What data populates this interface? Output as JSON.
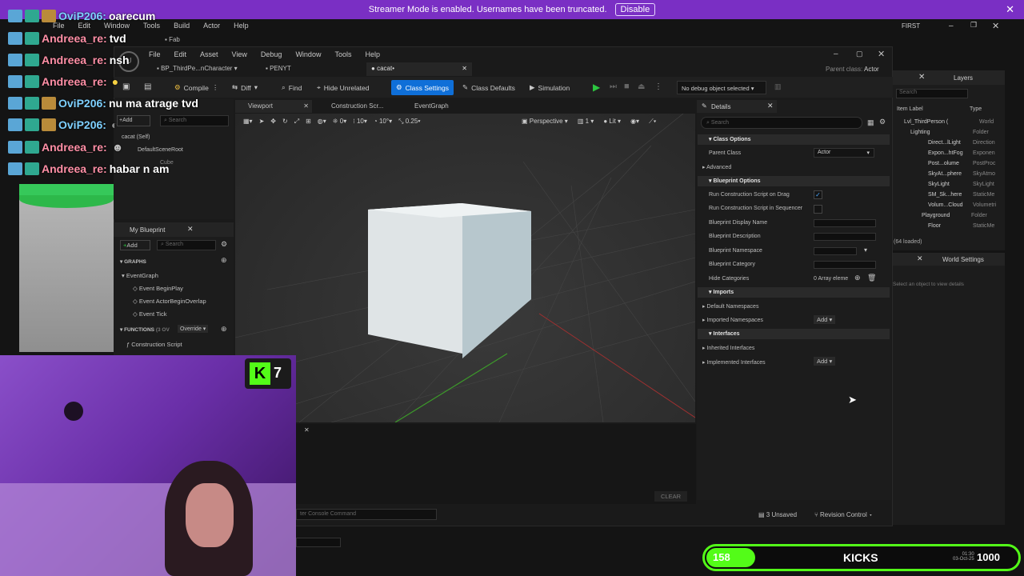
{
  "banner": {
    "text": "Streamer Mode is enabled. Usernames have been truncated.",
    "button": "Disable"
  },
  "back_window": {
    "menu": [
      "File",
      "Edit",
      "Window",
      "Tools",
      "Build",
      "Actor",
      "Help"
    ],
    "tab": "Fab",
    "mode": "FIRST"
  },
  "editor": {
    "menu": [
      "File",
      "Edit",
      "Asset",
      "View",
      "Debug",
      "Window",
      "Tools",
      "Help"
    ],
    "tabs": [
      "BP_ThirdPe...nCharacter",
      "PENYT",
      "cacat"
    ],
    "parent_class_label": "Parent class:",
    "parent_class_value": "Actor",
    "toolbar": {
      "compile": "Compile",
      "diff": "Diff",
      "find": "Find",
      "hide_unrelated": "Hide Unrelated",
      "class_settings": "Class Settings",
      "class_defaults": "Class Defaults",
      "simulation": "Simulation",
      "debug_object": "No debug object selected"
    },
    "components": {
      "add": "Add",
      "search": "Search",
      "self": "cacat (Self)",
      "root": "DefaultSceneRoot",
      "child": "Cube"
    },
    "my_blueprint": {
      "title": "My Blueprint",
      "add": "Add",
      "search": "Search",
      "graphs": "GRAPHS",
      "event_graph": "EventGraph",
      "events": [
        "Event BeginPlay",
        "Event ActorBeginOverlap",
        "Event Tick"
      ],
      "functions": "FUNCTIONS",
      "functions_count": "(3 OV",
      "override": "Override",
      "construction": "Construction Script"
    },
    "viewport_tabs": [
      "Viewport",
      "Construction Scr...",
      "EventGraph"
    ],
    "viewport_toolbar": {
      "snap1": "0",
      "snap2": "10",
      "snap3": "10°",
      "scale": "0.25",
      "perspective": "Perspective",
      "lit": "Lit",
      "speed": "1"
    },
    "details": {
      "title": "Details",
      "search": "Search",
      "class_options": "Class Options",
      "parent_class": "Parent Class",
      "parent_value": "Actor",
      "advanced": "Advanced",
      "blueprint_options": "Blueprint Options",
      "bp_rows": [
        "Run Construction Script on Drag",
        "Run Construction Script in Sequencer",
        "Blueprint Display Name",
        "Blueprint Description",
        "Blueprint Namespace",
        "Blueprint Category",
        "Hide Categories"
      ],
      "array_label": "0 Array eleme",
      "imports": "Imports",
      "default_ns": "Default Namespaces",
      "imported_ns": "Imported Namespaces",
      "add": "Add",
      "interfaces": "Interfaces",
      "inherited": "Inherited Interfaces",
      "implemented": "Implemented Interfaces"
    },
    "console": {
      "placeholder": "ter Console Command",
      "clear": "CLEAR",
      "unsaved": "3 Unsaved",
      "revision": "Revision Control"
    }
  },
  "layers": {
    "title": "Layers",
    "search": "Search",
    "col_label": "Item Label",
    "col_type": "Type",
    "items": [
      {
        "label": "Lvl_ThirdPerson (",
        "type": "World"
      },
      {
        "label": "Lighting",
        "type": "Folder"
      },
      {
        "label": "Direct...lLight",
        "type": "Direction"
      },
      {
        "label": "Expon...htFog",
        "type": "Exponen"
      },
      {
        "label": "Post...olume",
        "type": "PostProc"
      },
      {
        "label": "SkyAt...phere",
        "type": "SkyAtmo"
      },
      {
        "label": "SkyLight",
        "type": "SkyLight"
      },
      {
        "label": "SM_Sk...here",
        "type": "StaticMe"
      },
      {
        "label": "Volum...Cloud",
        "type": "Volumetri"
      },
      {
        "label": "Playground",
        "type": "Folder"
      },
      {
        "label": "Floor",
        "type": "StaticMe"
      }
    ],
    "loaded": "(64 loaded)",
    "world_settings": "World Settings",
    "world_hint": "Select an object to view details"
  },
  "chat": [
    {
      "user": "OviP206:",
      "text": "oarecum",
      "kind": "a"
    },
    {
      "user": "Andreea_re:",
      "text": "tvd",
      "kind": "b"
    },
    {
      "user": "Andreea_re:",
      "text": "nsh",
      "kind": "b"
    },
    {
      "user": "Andreea_re:",
      "text": "",
      "kind": "b"
    },
    {
      "user": "OviP206:",
      "text": "nu ma atrage tvd",
      "kind": "a"
    },
    {
      "user": "OviP206:",
      "text": "",
      "kind": "a"
    },
    {
      "user": "Andreea_re:",
      "text": "",
      "kind": "b"
    },
    {
      "user": "Andreea_re:",
      "text": "habar n am",
      "kind": "b"
    }
  ],
  "overlay": {
    "k_count": "7",
    "kicks_value": "158",
    "kicks_label": "KICKS",
    "kicks_goal": "1000",
    "time": "01:30",
    "date": "03-Oct-25",
    "progress": 0.158
  },
  "colors": {
    "accent": "#0f6fd8",
    "banner": "#7a2fc4",
    "kick_green": "#53fc18",
    "play": "#2cc640"
  }
}
